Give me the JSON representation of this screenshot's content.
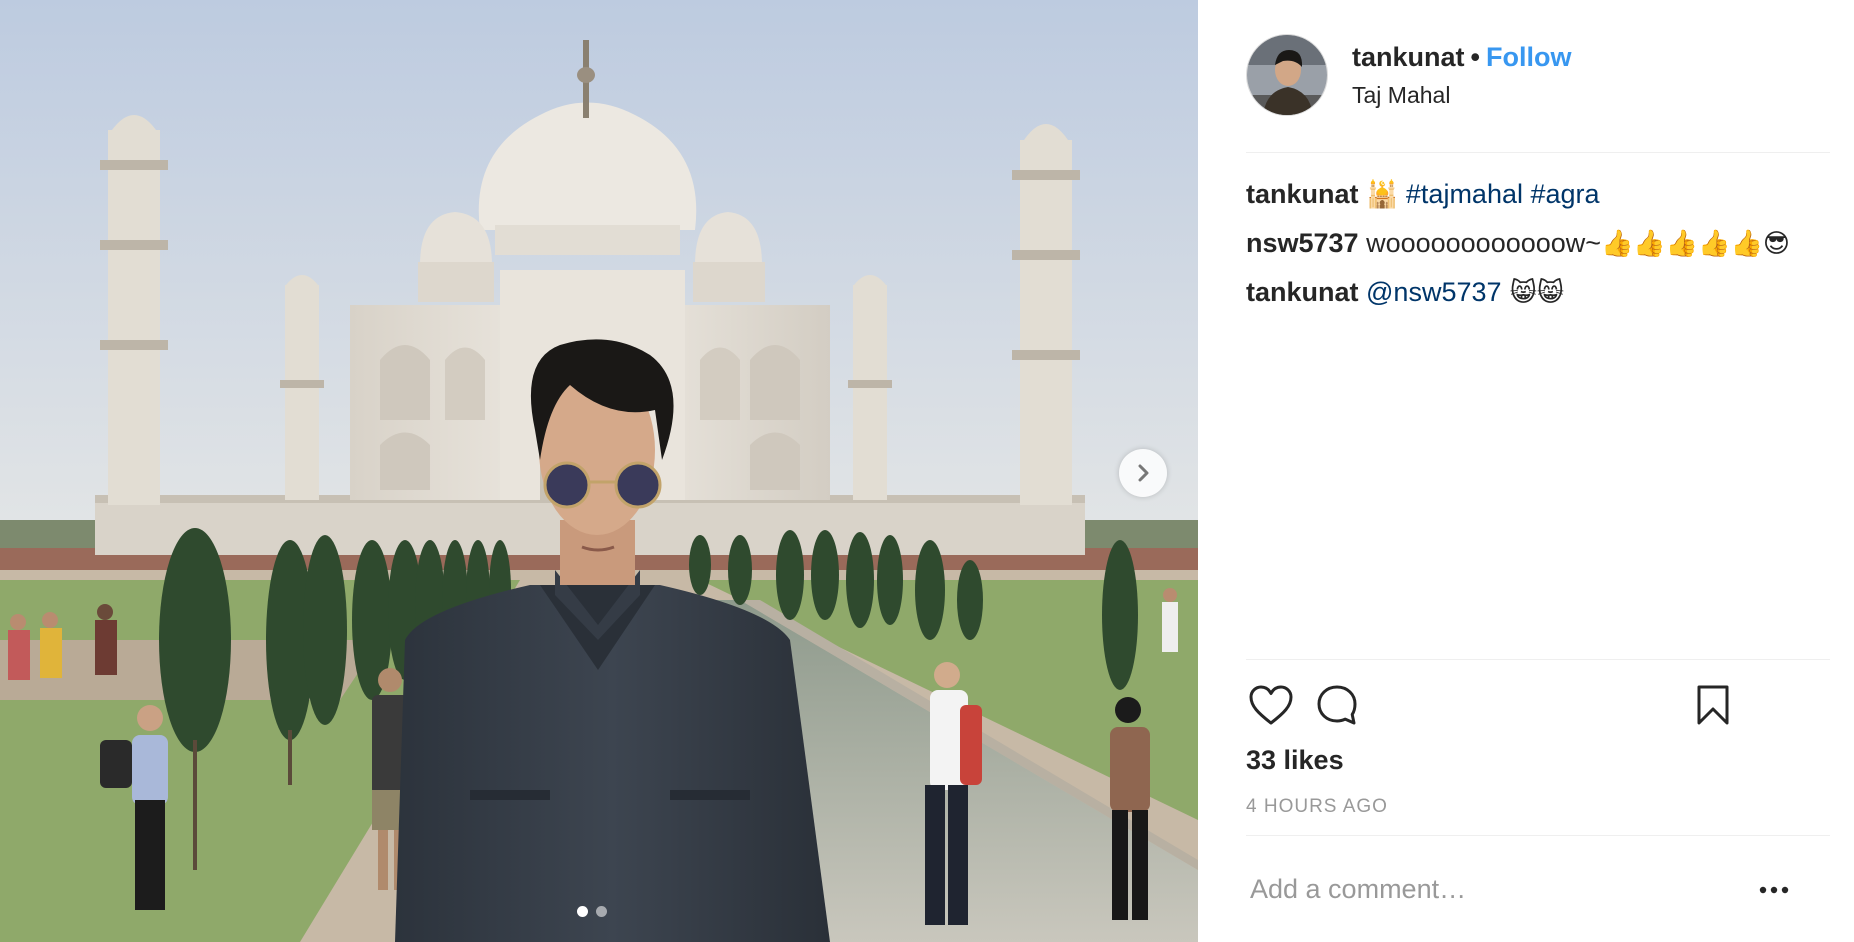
{
  "post": {
    "photo": {
      "description_icon": "photo",
      "carousel": {
        "count": 2,
        "active": 1
      },
      "next_icon": "chevron-right-icon"
    },
    "header": {
      "username": "tankunat",
      "bullet": "•",
      "follow_label": "Follow",
      "location": "Taj Mahal"
    },
    "comments": [
      {
        "user": "tankunat",
        "parts": [
          {
            "type": "emoji",
            "text": "🕌"
          },
          {
            "type": "tag",
            "text": " #tajmahal #agra"
          }
        ]
      },
      {
        "user": "nsw5737",
        "parts": [
          {
            "type": "text",
            "text": " woooooooooooow~"
          },
          {
            "type": "emoji",
            "text": "👍👍👍👍👍😎"
          }
        ]
      },
      {
        "user": "tankunat",
        "parts": [
          {
            "type": "tag",
            "text": " @nsw5737"
          },
          {
            "type": "emoji",
            "text": " 😸😸"
          }
        ]
      }
    ],
    "actions": {
      "like_icon": "heart-icon",
      "comment_icon": "comment-bubble-icon",
      "save_icon": "bookmark-icon"
    },
    "likes": "33 likes",
    "time": "4 HOURS AGO",
    "add_comment_placeholder": "Add a comment…",
    "more_icon": "more-options-icon",
    "colors": {
      "link": "#3897f0",
      "hashtag": "#003569",
      "muted": "#999999",
      "divider": "#efefef",
      "text": "#262626"
    }
  }
}
